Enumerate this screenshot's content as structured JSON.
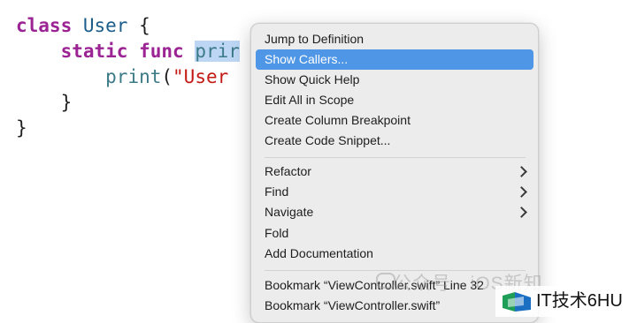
{
  "editor": {
    "line1": {
      "keyword": "class",
      "type_name": "User",
      "brace": " {"
    },
    "line2": {
      "indent": "    ",
      "kw_static": "static",
      "kw_func": "func",
      "selected_name": "prir"
    },
    "line3": {
      "indent": "        ",
      "call": "print",
      "open": "(",
      "string_fragment": "\"User"
    },
    "line4": {
      "text": "    }"
    },
    "line5": {
      "text": "}"
    }
  },
  "context_menu": {
    "items": [
      {
        "label": "Jump to Definition"
      },
      {
        "label": "Show Callers..."
      },
      {
        "label": "Show Quick Help"
      },
      {
        "label": "Edit All in Scope"
      },
      {
        "label": "Create Column Breakpoint"
      },
      {
        "label": "Create Code Snippet..."
      },
      {
        "label": "Refactor"
      },
      {
        "label": "Find"
      },
      {
        "label": "Navigate"
      },
      {
        "label": "Fold"
      },
      {
        "label": "Add Documentation"
      },
      {
        "label": "Bookmark “ViewController.swift” Line 32"
      },
      {
        "label": "Bookmark “ViewController.swift”"
      }
    ],
    "highlighted_item": "Show Callers...",
    "submenu_indicator": "chevron-right-icon"
  },
  "watermark": {
    "text": "公众号 · iOS新知",
    "brand": "IT技术6HU"
  },
  "colors": {
    "highlight": "#4f96e6",
    "keyword": "#9b2393",
    "type": "#1c5d8a",
    "string": "#c41a16",
    "selection": "#bcd6f3"
  }
}
